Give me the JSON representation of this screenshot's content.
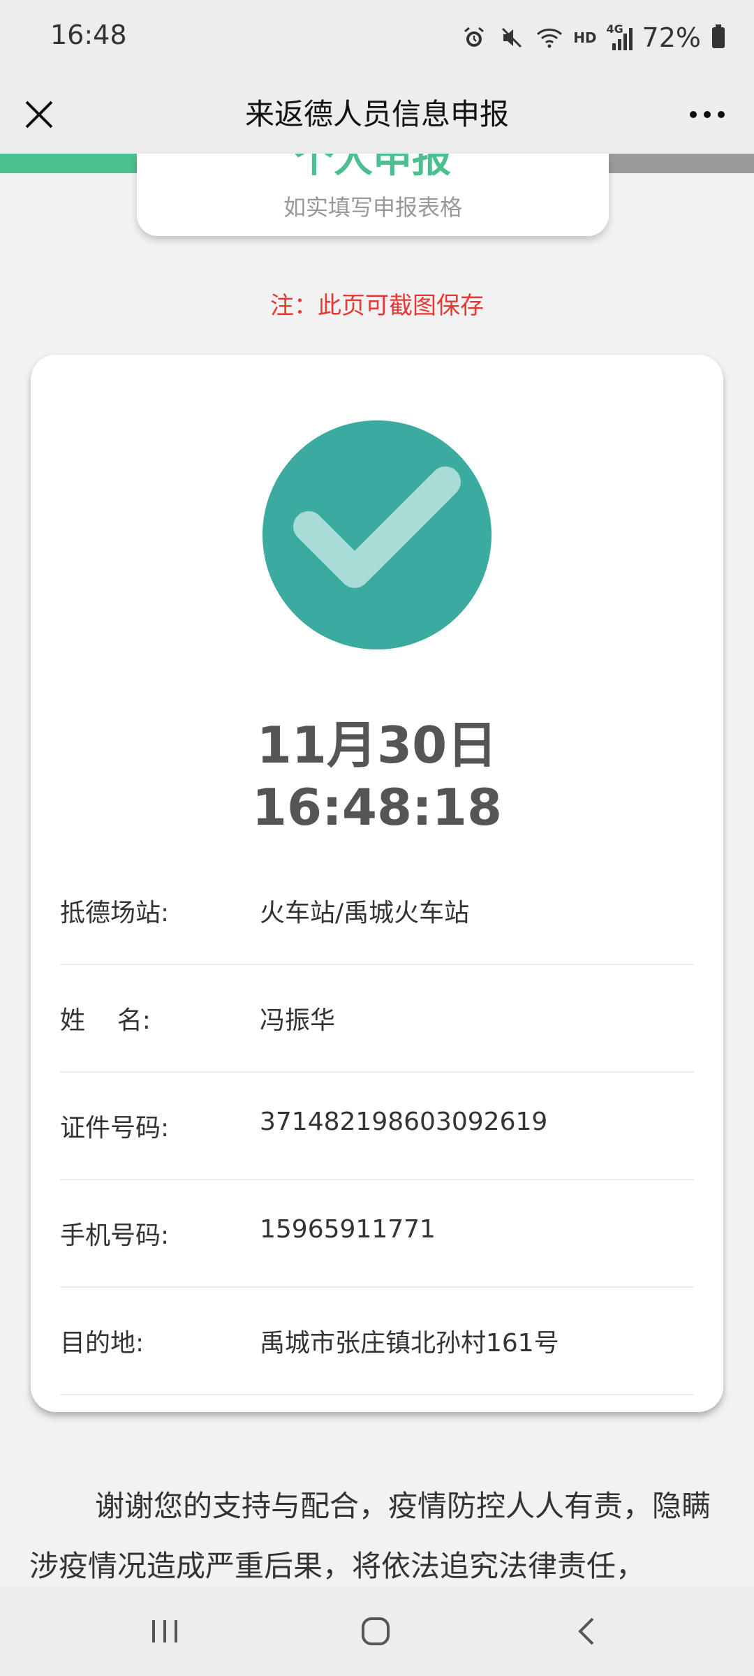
{
  "status_bar": {
    "time": "16:48",
    "hd_label": "HD",
    "network_label": "4G",
    "battery_percent": "72%",
    "icons": [
      "alarm-icon",
      "mute-icon",
      "wifi-icon",
      "signal-icon",
      "battery-icon"
    ]
  },
  "title_bar": {
    "title": "来返德人员信息申报"
  },
  "banner": {
    "title": "个人申报",
    "subtitle": "如实填写申报表格",
    "accent_color": "#4bbf8f"
  },
  "note": "注：此页可截图保存",
  "result": {
    "check_color": "#3aab9e",
    "date": "11月30日",
    "time": "16:48:18",
    "rows": [
      {
        "label": "抵德场站:",
        "value": "火车站/禹城火车站"
      },
      {
        "label": "姓    名:",
        "value": "冯振华"
      },
      {
        "label": "证件号码:",
        "value": "371482198603092619"
      },
      {
        "label": "手机号码:",
        "value": "15965911771"
      },
      {
        "label": "目的地:",
        "value": "禹城市张庄镇北孙村161号"
      }
    ]
  },
  "footer": {
    "text": "谢谢您的支持与配合，疫情防控人人有责，隐瞒涉疫情况造成严重后果，将依法追究法律责任，"
  }
}
